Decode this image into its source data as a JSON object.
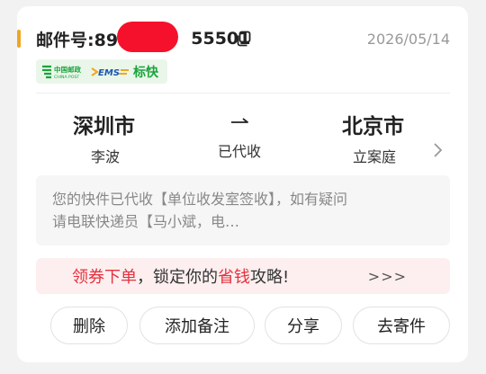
{
  "waybill": {
    "label": "邮件号:895",
    "suffix": "55501",
    "date": "2026/05/14"
  },
  "carrier": {
    "china_post_cn": "中国邮政",
    "china_post_en": "CHINA POST",
    "ems": "EMS",
    "service": "标快"
  },
  "route": {
    "from_city": "深圳市",
    "from_person": "李波",
    "status": "已代收",
    "to_city": "北京市",
    "to_person": "立案庭"
  },
  "message": {
    "line1": "您的快件已代收【单位收发室签收】，如有疑问",
    "line2": "请电联快递员【马小斌，电…"
  },
  "promo": {
    "part1": "领券下单",
    "part2": "，锁定你的",
    "part3": "省钱",
    "part4": "攻略!",
    "more": ">>>"
  },
  "actions": {
    "delete": "删除",
    "add_note": "添加备注",
    "share": "分享",
    "send_again": "去寄件"
  },
  "colors": {
    "accent": "#f0a623",
    "promo_red": "#e5303f",
    "carrier_green": "#1aa33b",
    "redaction": "#f5112b"
  },
  "icons": [
    "copy-icon",
    "china-post-logo",
    "ems-logo",
    "arrow-icon",
    "chevron-right-icon"
  ]
}
